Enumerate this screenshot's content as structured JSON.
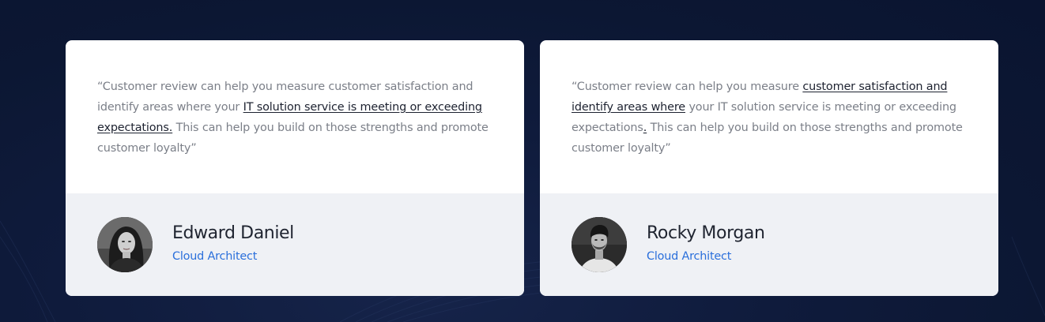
{
  "testimonials": [
    {
      "quote": {
        "part1": "“Customer review can help you measure customer satisfaction and identify areas where your ",
        "highlight": "IT solution service is meeting or exceeding expectations.",
        "part2": " This can help you build on those strengths and promote customer loyalty”"
      },
      "name": "Edward Daniel",
      "role": "Cloud Architect",
      "avatar_icon": "woman-portrait-photo"
    },
    {
      "quote": {
        "part1": "“Customer review can help you measure ",
        "highlight": "customer satisfaction and identify areas where",
        "part2": " your IT solution service is meeting or exceeding expectations",
        "highlight2": ".",
        "part3": " This can help you build on those strengths and promote customer loyalty”"
      },
      "name": "Rocky Morgan",
      "role": "Cloud Architect",
      "avatar_icon": "man-portrait-photo"
    }
  ],
  "colors": {
    "background": "#0f1b3c",
    "card": "#ffffff",
    "card_footer": "#eff1f5",
    "role_accent": "#2a6fdb",
    "quote_text": "#7b7f88"
  }
}
